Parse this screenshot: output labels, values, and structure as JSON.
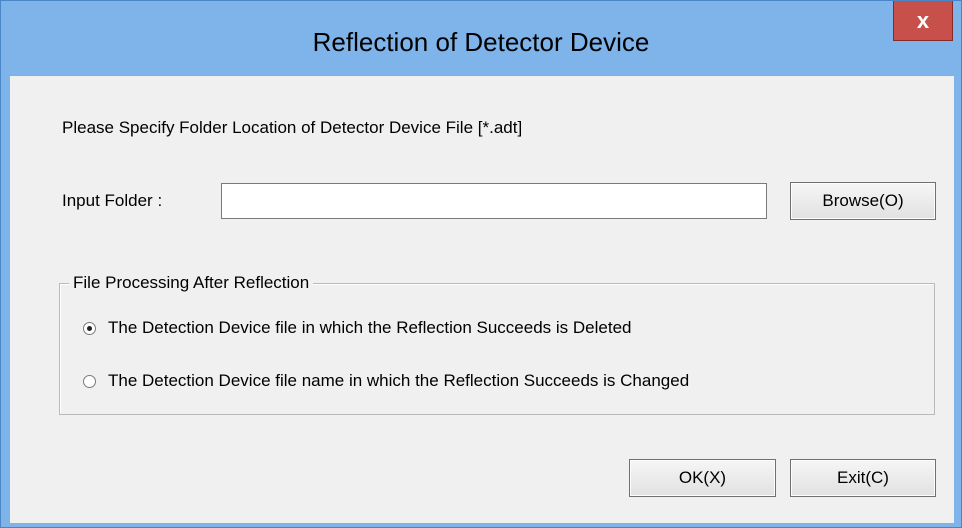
{
  "window": {
    "title": "Reflection of Detector Device",
    "close_label": "x"
  },
  "instruction": "Please Specify Folder Location of Detector Device File [*.adt]",
  "input_folder": {
    "label": "Input Folder :",
    "value": "",
    "browse_label": "Browse(O)"
  },
  "file_processing": {
    "legend": "File Processing After Reflection",
    "options": [
      {
        "label": "The Detection Device file in which the Reflection Succeeds is Deleted",
        "checked": true
      },
      {
        "label": "The Detection Device file name in which the Reflection Succeeds is Changed",
        "checked": false
      }
    ]
  },
  "buttons": {
    "ok_label": "OK(X)",
    "exit_label": "Exit(C)"
  },
  "colors": {
    "titlebar": "#7eb4ea",
    "close_button": "#c7504b",
    "client": "#f0f0f0"
  }
}
